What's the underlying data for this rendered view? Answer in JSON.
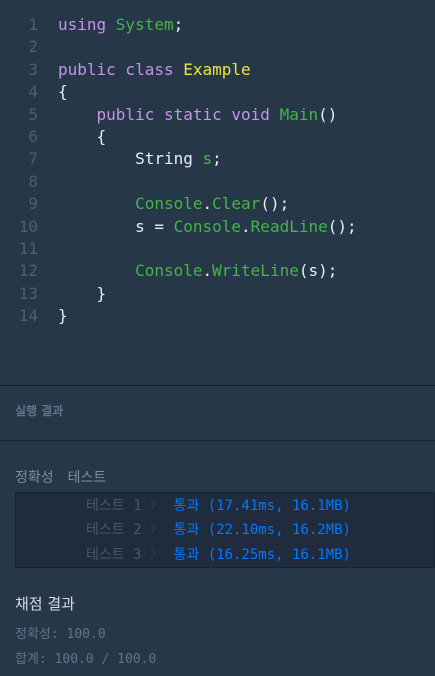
{
  "code": {
    "lines": [
      {
        "n": "1",
        "tokens": [
          [
            "kw",
            "using "
          ],
          [
            "ty",
            "System"
          ],
          [
            "pu",
            ";"
          ]
        ]
      },
      {
        "n": "2",
        "tokens": []
      },
      {
        "n": "3",
        "tokens": [
          [
            "kw",
            "public class "
          ],
          [
            "cl",
            "Example"
          ]
        ]
      },
      {
        "n": "4",
        "tokens": [
          [
            "pu",
            "{"
          ]
        ]
      },
      {
        "n": "5",
        "tokens": [
          [
            "pl",
            "    "
          ],
          [
            "kw",
            "public static void "
          ],
          [
            "fn",
            "Main"
          ],
          [
            "pu",
            "()"
          ]
        ]
      },
      {
        "n": "6",
        "tokens": [
          [
            "pu",
            "    {"
          ]
        ]
      },
      {
        "n": "7",
        "tokens": [
          [
            "pl",
            "        String "
          ],
          [
            "ty",
            "s"
          ],
          [
            "pu",
            ";"
          ]
        ]
      },
      {
        "n": "8",
        "tokens": []
      },
      {
        "n": "9",
        "tokens": [
          [
            "pl",
            "        "
          ],
          [
            "ty",
            "Console"
          ],
          [
            "pu",
            "."
          ],
          [
            "fn",
            "Clear"
          ],
          [
            "pu",
            "();"
          ]
        ]
      },
      {
        "n": "10",
        "tokens": [
          [
            "pl",
            "        s = "
          ],
          [
            "ty",
            "Console"
          ],
          [
            "pu",
            "."
          ],
          [
            "fn",
            "ReadLine"
          ],
          [
            "pu",
            "();"
          ]
        ]
      },
      {
        "n": "11",
        "tokens": []
      },
      {
        "n": "12",
        "tokens": [
          [
            "pl",
            "        "
          ],
          [
            "ty",
            "Console"
          ],
          [
            "pu",
            "."
          ],
          [
            "fn",
            "WriteLine"
          ],
          [
            "pu",
            "(s);"
          ]
        ]
      },
      {
        "n": "13",
        "tokens": [
          [
            "pu",
            "    }"
          ]
        ]
      },
      {
        "n": "14",
        "tokens": [
          [
            "pu",
            "}"
          ]
        ]
      }
    ]
  },
  "result": {
    "section_title": "실행 결과",
    "tests_label_1": "정확성",
    "tests_label_2": "테스트",
    "tests": [
      {
        "name": "테스트 1",
        "status": "통과 (17.41ms, 16.1MB)"
      },
      {
        "name": "테스트 2",
        "status": "통과 (22.10ms, 16.2MB)"
      },
      {
        "name": "테스트 3",
        "status": "통과 (16.25ms, 16.1MB)"
      }
    ],
    "grade_title": "채점 결과",
    "accuracy": "정확성: 100.0",
    "total": "합계: 100.0 / 100.0"
  },
  "colors": {
    "background": "#263747",
    "pass": "#0078ff",
    "keyword": "#c792ea",
    "type": "#44b549",
    "class": "#f0e442"
  }
}
